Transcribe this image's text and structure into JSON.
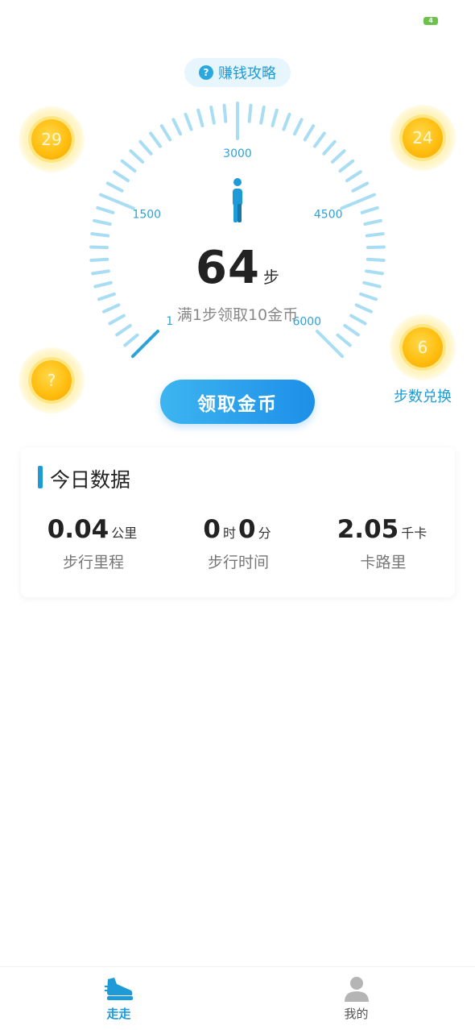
{
  "status_bar": {
    "battery": "4"
  },
  "strategy": {
    "label": "赚钱攻略",
    "icon": "help-icon"
  },
  "gauge": {
    "ticks": [
      {
        "label": "1",
        "value": 1
      },
      {
        "label": "1500",
        "value": 1500
      },
      {
        "label": "3000",
        "value": 3000
      },
      {
        "label": "4500",
        "value": 4500
      },
      {
        "label": "6000",
        "value": 6000
      }
    ],
    "min": 0,
    "max": 6000,
    "steps": "64",
    "steps_unit": "步",
    "rule_text": "满1步领取10金币",
    "track_color": "#a8ddf4",
    "progress_color": "#2aa3d8"
  },
  "coins": {
    "top_left": "29",
    "top_right": "24",
    "bottom_left": "?",
    "bottom_right": "6",
    "exchange_label": "步数兑换"
  },
  "claim_button": {
    "label": "领取金币"
  },
  "today": {
    "title": "今日数据",
    "distance": {
      "value": "0.04",
      "unit": "公里",
      "label": "步行里程"
    },
    "time": {
      "hours": "0",
      "hours_unit": "时",
      "minutes": "0",
      "minutes_unit": "分",
      "label": "步行时间"
    },
    "calories": {
      "value": "2.05",
      "unit": "千卡",
      "label": "卡路里"
    }
  },
  "tabs": [
    {
      "label": "走走",
      "icon": "shoe-icon",
      "active": true
    },
    {
      "label": "我的",
      "icon": "user-icon",
      "active": false
    }
  ]
}
